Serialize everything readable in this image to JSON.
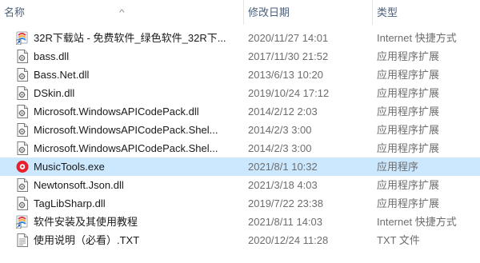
{
  "columns": {
    "name": "名称",
    "date": "修改日期",
    "type": "类型"
  },
  "files": [
    {
      "name": "32R下载站 - 免费软件_绿色软件_32R下...",
      "date": "2020/11/27 14:01",
      "type": "Internet 快捷方式",
      "icon": "internet-shortcut-icon"
    },
    {
      "name": "bass.dll",
      "date": "2017/11/30 21:52",
      "type": "应用程序扩展",
      "icon": "dll-file-icon"
    },
    {
      "name": "Bass.Net.dll",
      "date": "2013/6/13 10:20",
      "type": "应用程序扩展",
      "icon": "dll-file-icon"
    },
    {
      "name": "DSkin.dll",
      "date": "2019/10/24 17:12",
      "type": "应用程序扩展",
      "icon": "dll-file-icon"
    },
    {
      "name": "Microsoft.WindowsAPICodePack.dll",
      "date": "2014/2/12 2:03",
      "type": "应用程序扩展",
      "icon": "dll-file-icon"
    },
    {
      "name": "Microsoft.WindowsAPICodePack.Shel...",
      "date": "2014/2/3 3:00",
      "type": "应用程序扩展",
      "icon": "dll-file-icon"
    },
    {
      "name": "Microsoft.WindowsAPICodePack.Shel...",
      "date": "2014/2/3 3:00",
      "type": "应用程序扩展",
      "icon": "dll-file-icon"
    },
    {
      "name": "MusicTools.exe",
      "date": "2021/8/1 10:32",
      "type": "应用程序",
      "icon": "music-app-icon",
      "selected": true
    },
    {
      "name": "Newtonsoft.Json.dll",
      "date": "2021/3/18 4:03",
      "type": "应用程序扩展",
      "icon": "dll-file-icon"
    },
    {
      "name": "TagLibSharp.dll",
      "date": "2019/7/22 23:38",
      "type": "应用程序扩展",
      "icon": "dll-file-icon"
    },
    {
      "name": "软件安装及其使用教程",
      "date": "2021/8/11 14:03",
      "type": "Internet 快捷方式",
      "icon": "internet-shortcut-icon"
    },
    {
      "name": "使用说明（必看）.TXT",
      "date": "2020/12/24 11:28",
      "type": "TXT 文件",
      "icon": "text-file-icon"
    }
  ],
  "colors": {
    "selected_row": "#cce8ff",
    "header_text": "#4c607a"
  }
}
